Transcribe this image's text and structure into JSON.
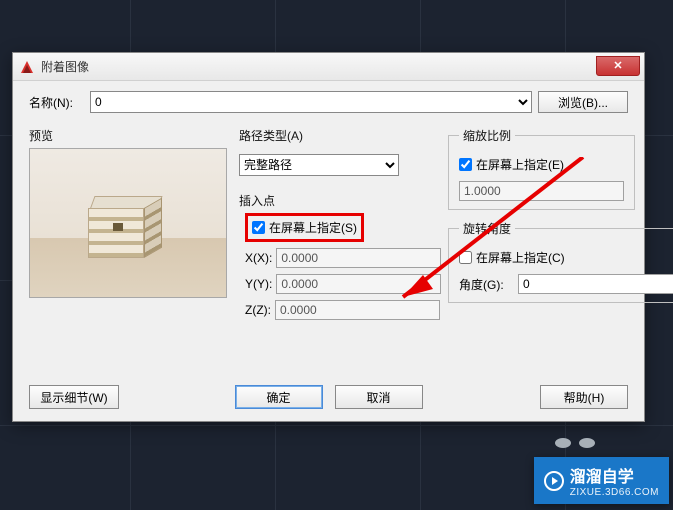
{
  "window": {
    "title": "附着图像"
  },
  "name_row": {
    "label": "名称(N):",
    "value": "0",
    "browse": "浏览(B)..."
  },
  "preview": {
    "label": "预览"
  },
  "path": {
    "legend": "路径类型(A)",
    "value": "完整路径"
  },
  "insert": {
    "legend": "插入点",
    "specify": "在屏幕上指定(S)",
    "x_label": "X(X):",
    "y_label": "Y(Y):",
    "z_label": "Z(Z):",
    "x": "0.0000",
    "y": "0.0000",
    "z": "0.0000"
  },
  "scale": {
    "legend": "缩放比例",
    "specify": "在屏幕上指定(E)",
    "value": "1.0000"
  },
  "rotate": {
    "legend": "旋转角度",
    "specify": "在屏幕上指定(C)",
    "angle_label": "角度(G):",
    "angle": "0"
  },
  "footer": {
    "details": "显示细节(W)",
    "ok": "确定",
    "cancel": "取消",
    "help": "帮助(H)"
  },
  "watermark": {
    "brand": "溜溜自学",
    "url": "ZIXUE.3D66.COM"
  }
}
